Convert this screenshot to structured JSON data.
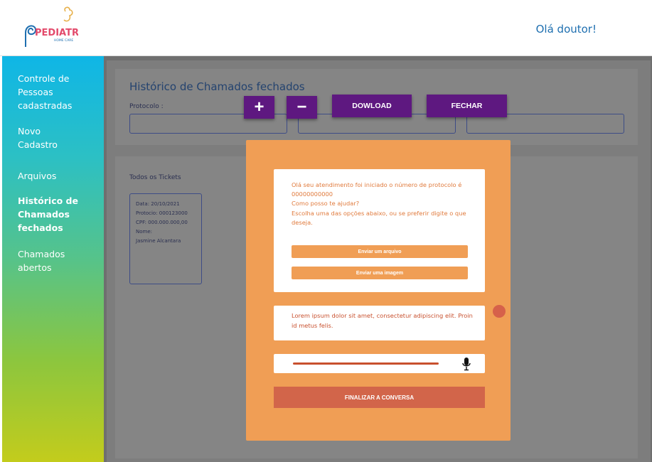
{
  "header": {
    "logo_text": "PEDIATRIC",
    "logo_subtitle": "HOME CARE",
    "greeting": "Olá doutor!"
  },
  "sidebar": {
    "items": [
      {
        "label": "Controle de Pessoas cadastradas",
        "active": false
      },
      {
        "label": "Novo Cadastro",
        "active": false
      },
      {
        "label": "Arquivos",
        "active": false
      },
      {
        "label": "Histórico de Chamados fechados",
        "active": true
      },
      {
        "label": "Chamados abertos",
        "active": false
      }
    ]
  },
  "history": {
    "title": "Histórico de Chamados fechados",
    "protocol_label": "Protocolo :"
  },
  "toolbar": {
    "zoom_in": "+",
    "zoom_out": "−",
    "download": "DOWLOAD",
    "close": "FECHAR"
  },
  "tickets": {
    "section_label": "Todos os Tickets",
    "items": [
      {
        "date": "Data: 20/10/2021",
        "protocol": "Protocio: 000123000",
        "cpf": "CPF: 000.000.000,00",
        "name_label": "Nome:",
        "name": "Jasmine Alcantara"
      }
    ]
  },
  "chat": {
    "bot_message": "Olá seu atendimento foi iniciado o número de protocolo é 00000000000\nComo posso te ajudar?\nEscolha uma das opções abaixo, ou se preferir digite o que deseja.",
    "option_file": "Enviar um arquivo",
    "option_image": "Enviar uma imagem",
    "user_message": "Lorem ipsum dolor sit amet, consectetur  adipiscing elit. Proin id metus felis.",
    "finish_button": "FINALIZAR A CONVERSA"
  },
  "colors": {
    "toolbar_button": "#5e1880",
    "modal_bg": "#f09e55",
    "finish_button": "#d2654a",
    "accent_blue": "#1e6fb0"
  }
}
